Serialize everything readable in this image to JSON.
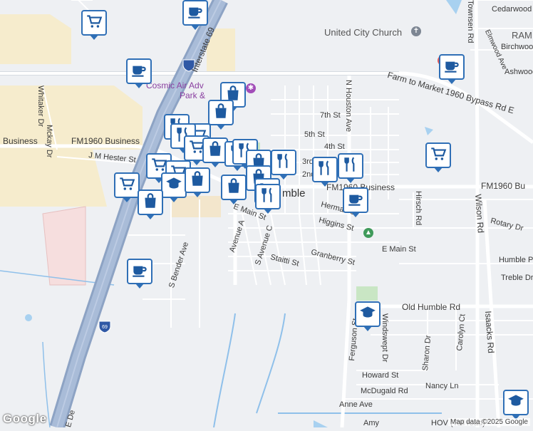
{
  "map": {
    "place_labels": [
      {
        "text": "United City Church"
      },
      {
        "text": "RAM"
      },
      {
        "text": "Cosmic Air Adv"
      },
      {
        "text": "Park &"
      },
      {
        "text": "mble"
      }
    ],
    "road_labels": [
      {
        "text": "Interstate 69"
      },
      {
        "text": "Farm to Market 1960 Bypass Rd E"
      },
      {
        "text": "FM1960 Business"
      },
      {
        "text": "FM1960 Business"
      },
      {
        "text": "Business"
      },
      {
        "text": "FM1960 Bu"
      },
      {
        "text": "J M Hester St"
      },
      {
        "text": "Whitaker Dr"
      },
      {
        "text": "Mckay Dr"
      },
      {
        "text": "7th St"
      },
      {
        "text": "5th St"
      },
      {
        "text": "4th St"
      },
      {
        "text": "3rd"
      },
      {
        "text": "2nd"
      },
      {
        "text": "N Houston Ave"
      },
      {
        "text": "Townsen Rd"
      },
      {
        "text": "Cedarwood"
      },
      {
        "text": "Elmwood Ave"
      },
      {
        "text": "Birchwood"
      },
      {
        "text": "Ashwood"
      },
      {
        "text": "E Main St"
      },
      {
        "text": "E Main St"
      },
      {
        "text": "Herman St"
      },
      {
        "text": "Higgins St"
      },
      {
        "text": "Granberry St"
      },
      {
        "text": "Staitti St"
      },
      {
        "text": "S Avenue C"
      },
      {
        "text": "Avenue A"
      },
      {
        "text": "S Bender Ave"
      },
      {
        "text": "Hirsch Rd"
      },
      {
        "text": "Rotary Dr"
      },
      {
        "text": "Humble Pl D"
      },
      {
        "text": "Treble Dr"
      },
      {
        "text": "Wilson Rd"
      },
      {
        "text": "Isaacks Rd"
      },
      {
        "text": "Old Humble Rd"
      },
      {
        "text": "Ferguson St"
      },
      {
        "text": "Windswept Dr"
      },
      {
        "text": "Sharon Dr"
      },
      {
        "text": "Carolyn Ct"
      },
      {
        "text": "Howard St"
      },
      {
        "text": "McDugald Rd"
      },
      {
        "text": "Anne Ave"
      },
      {
        "text": "Nancy Ln"
      },
      {
        "text": "Amy"
      },
      {
        "text": "HOV (Toll road)"
      },
      {
        "text": "E De"
      },
      {
        "text": "Dr"
      }
    ],
    "highway_shield": "69",
    "logo": "Google",
    "attribution": "Map data ©2025 Google",
    "marker_color": "#2f6fb6",
    "markers": [
      {
        "icon": "cart-icon"
      },
      {
        "icon": "coffee-icon"
      },
      {
        "icon": "coffee-icon"
      },
      {
        "icon": "coffee-icon"
      },
      {
        "icon": "bag-icon"
      },
      {
        "icon": "bag-icon"
      },
      {
        "icon": "restaurant-icon"
      },
      {
        "icon": "cart-icon"
      },
      {
        "icon": "restaurant-icon"
      },
      {
        "icon": "cart-icon"
      },
      {
        "icon": "bag-icon"
      },
      {
        "icon": "restaurant-icon"
      },
      {
        "icon": "restaurant-icon"
      },
      {
        "icon": "bag-icon"
      },
      {
        "icon": "restaurant-icon"
      },
      {
        "icon": "cart-icon"
      },
      {
        "icon": "cart-icon"
      },
      {
        "icon": "cart-icon"
      },
      {
        "icon": "school-icon"
      },
      {
        "icon": "bag-icon"
      },
      {
        "icon": "bag-icon"
      },
      {
        "icon": "bag-icon"
      },
      {
        "icon": "bag-icon"
      },
      {
        "icon": "cart-icon"
      },
      {
        "icon": "restaurant-icon"
      },
      {
        "icon": "restaurant-icon"
      },
      {
        "icon": "restaurant-icon"
      },
      {
        "icon": "coffee-icon"
      },
      {
        "icon": "cart-icon"
      },
      {
        "icon": "coffee-icon"
      },
      {
        "icon": "school-icon"
      },
      {
        "icon": "school-icon"
      }
    ]
  }
}
